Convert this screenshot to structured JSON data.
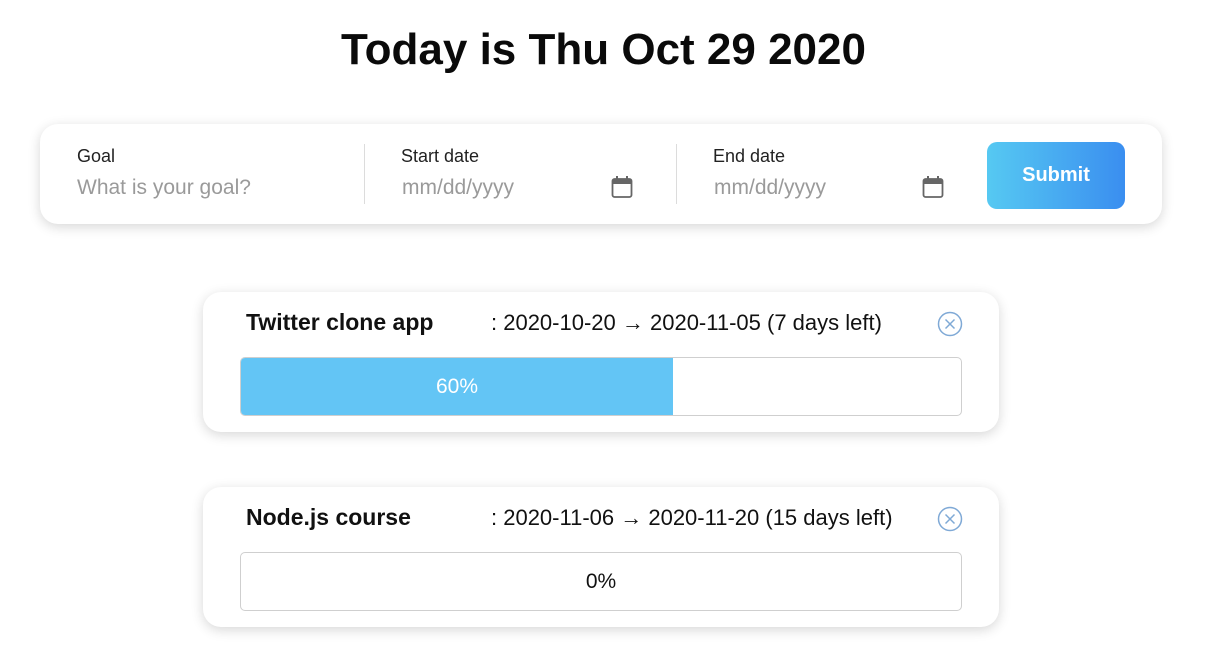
{
  "header": {
    "title": "Today is Thu Oct 29 2020"
  },
  "form": {
    "goal": {
      "label": "Goal",
      "placeholder": "What is your goal?"
    },
    "start_date": {
      "label": "Start date",
      "placeholder": "mm/dd/yyyy",
      "icon": "calendar-icon"
    },
    "end_date": {
      "label": "End date",
      "placeholder": "mm/dd/yyyy",
      "icon": "calendar-icon"
    },
    "submit_label": "Submit"
  },
  "goals": [
    {
      "name": "Twitter clone app",
      "dates": ": 2020-10-20 → 2020-11-05 (7 days left)",
      "progress": 60,
      "progress_label": "60%",
      "remove_icon": "circle-x-icon"
    },
    {
      "name": "Node.js course",
      "dates": ": 2020-11-06 → 2020-11-20 (15 days left)",
      "progress": 0,
      "progress_label": "0%",
      "remove_icon": "circle-x-icon"
    }
  ],
  "colors": {
    "accent_start": "#56c9f2",
    "accent_end": "#3a8ef0",
    "progress_fill": "#63c5f5",
    "placeholder": "#9a9a9a",
    "icon": "#7fa9d6"
  }
}
